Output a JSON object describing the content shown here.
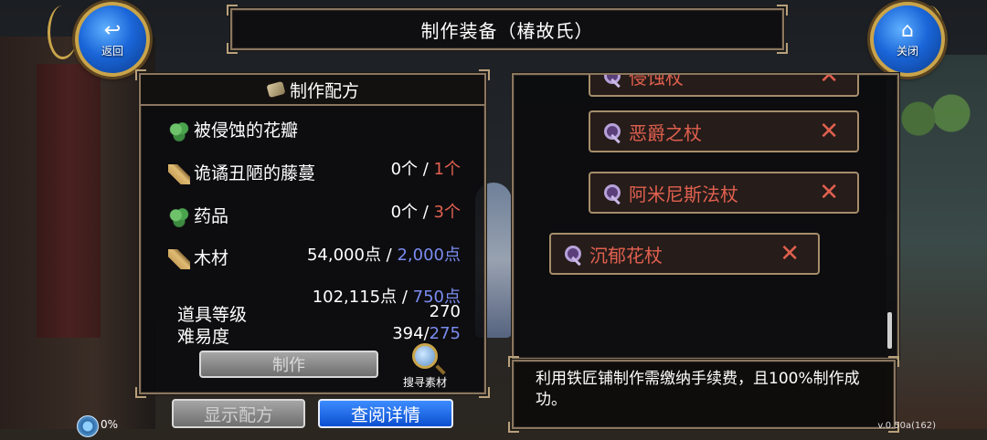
{
  "header": {
    "title": "制作装备（椿故氏）",
    "back_label": "返回",
    "back_icon": "back-arrow-icon",
    "close_label": "关闭",
    "close_icon": "home-icon"
  },
  "recipe": {
    "title": "制作配方",
    "materials": [
      {
        "name": "被侵蚀的花瓣",
        "icon": "leaf-icon",
        "have": "0个",
        "need": "1个",
        "need_color": "#e0604f"
      },
      {
        "name": "诡谲丑陋的藤蔓",
        "icon": "wood-icon",
        "have": "0个",
        "need": "3个",
        "need_color": "#e0604f"
      },
      {
        "name": "药品",
        "icon": "leaf-icon",
        "have": "54,000点",
        "need": "2,000点",
        "need_color": "#7a8cf0"
      },
      {
        "name": "木材",
        "icon": "wood-icon",
        "have": "102,115点",
        "need": "750点",
        "need_color": "#7a8cf0"
      }
    ],
    "separator": " / ",
    "item_level_label": "道具等级",
    "item_level_value": "270",
    "difficulty_label": "难易度",
    "difficulty_current": "394/",
    "difficulty_target": "275",
    "craft_label": "制作",
    "search_label": "搜寻素材"
  },
  "list": {
    "items": [
      {
        "name": "侵蚀杖"
      },
      {
        "name": "恶爵之杖"
      },
      {
        "name": "阿米尼斯法杖"
      },
      {
        "name": "沉郁花杖"
      }
    ]
  },
  "info": {
    "text": "利用铁匠铺制作需缴纳手续费，且100%制作成功。"
  },
  "buttons": {
    "show_recipe": "显示配方",
    "view_details": "查阅详情"
  },
  "status": {
    "percent": "0%",
    "version": "v.0.50a(162)"
  },
  "colors": {
    "red": "#e0604f",
    "blue": "#7a8cf0",
    "gold": "#c9a44a"
  }
}
